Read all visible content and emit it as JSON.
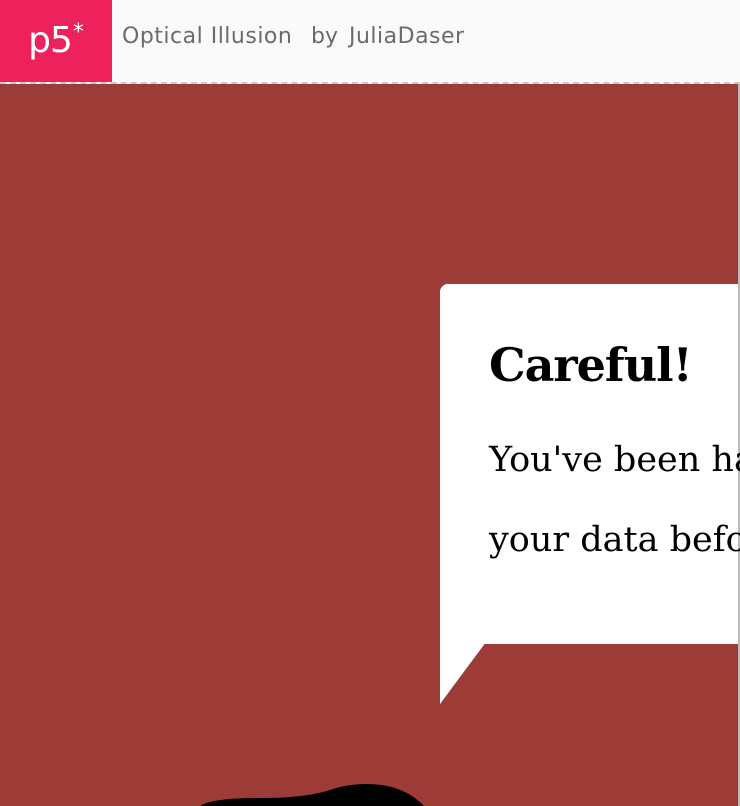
{
  "header": {
    "logo_text": "p5",
    "logo_star": "*",
    "sketch_title": "Optical Illusion",
    "by_label": "by",
    "author": "JuliaDaser"
  },
  "dialog": {
    "heading": "Careful!",
    "line1": "You've been ha",
    "line2": "your data befo"
  },
  "colors": {
    "background": "#9d3b37",
    "logo": "#ed225d",
    "header_bg": "#fafafa",
    "dialog_bg": "#ffffff",
    "text": "#000000"
  }
}
